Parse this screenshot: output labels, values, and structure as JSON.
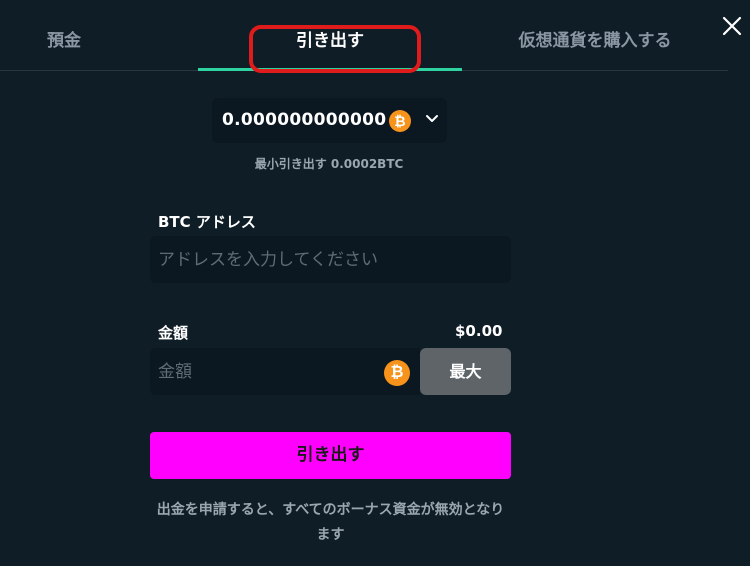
{
  "tabs": [
    {
      "label": "預金",
      "active": false
    },
    {
      "label": "引き出す",
      "active": true
    },
    {
      "label": "仮想通貨を購入する",
      "active": false
    }
  ],
  "colors": {
    "background": "#0f1d27",
    "field_background": "#0b1721",
    "active_tab_underline": "#2fd3a0",
    "highlight_ring": "#e01b1b",
    "primary_button": "#ff00ff",
    "max_button": "#5f6468",
    "btc": "#f7931a"
  },
  "currency_select": {
    "amount": "0.000000000000",
    "currency_icon": "btc-icon",
    "dropdown_icon": "chevron-down-icon"
  },
  "min_withdraw": "最小引き出す 0.0002BTC",
  "address_field": {
    "label": "BTC アドレス",
    "placeholder": "アドレスを入力してください",
    "value": ""
  },
  "amount_field": {
    "label": "金額",
    "usd_value": "$0.00",
    "placeholder": "金額",
    "value": "",
    "currency_icon": "btc-icon"
  },
  "max_button": {
    "label": "最大"
  },
  "withdraw_button": {
    "label": "引き出す"
  },
  "notice": "出金を申請すると、すべてのボーナス資金が無効となります",
  "btc_glyph": "₿"
}
